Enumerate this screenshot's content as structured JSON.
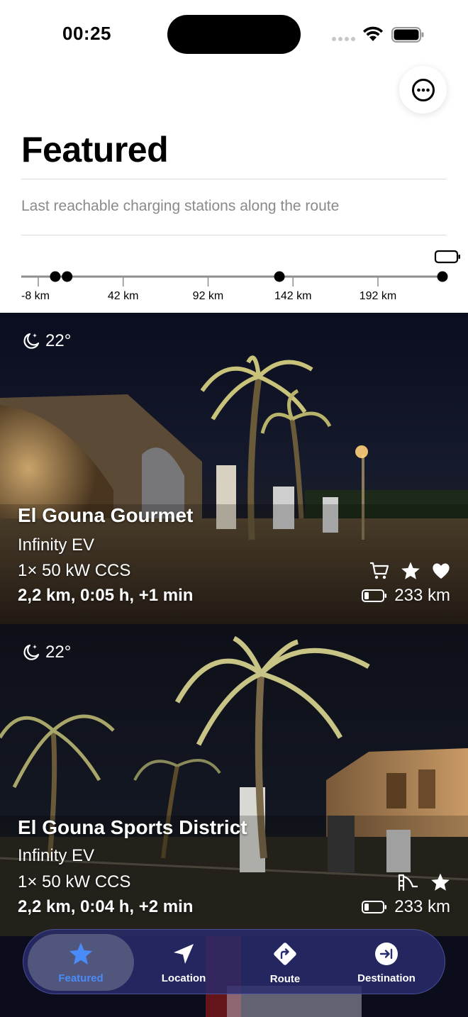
{
  "status_bar": {
    "time": "00:25"
  },
  "header": {
    "title": "Featured",
    "subtitle": "Last reachable charging stations along the route"
  },
  "timeline": {
    "ticks": [
      "-8 km",
      "42 km",
      "92 km",
      "142 km",
      "192 km"
    ],
    "station_markers_km": [
      2,
      9,
      134,
      230
    ]
  },
  "stations": [
    {
      "temperature": "22°",
      "name": "El Gouna Gourmet",
      "operator": "Infinity EV",
      "charger": "1× 50 kW CCS",
      "distance": "2,2 km, 0:05 h, +1 min",
      "range": "233 km",
      "amenities": [
        "cart-icon",
        "star-icon",
        "heart-icon"
      ]
    },
    {
      "temperature": "22°",
      "name": "El Gouna Sports District",
      "operator": "Infinity EV",
      "charger": "1× 50 kW CCS",
      "distance": "2,2 km, 0:04 h, +2 min",
      "range": "233 km",
      "amenities": [
        "playground-icon",
        "star-icon"
      ]
    }
  ],
  "tabs": [
    {
      "label": "Featured",
      "icon": "star-icon",
      "active": true
    },
    {
      "label": "Location",
      "icon": "location-arrow-icon",
      "active": false
    },
    {
      "label": "Route",
      "icon": "route-turn-icon",
      "active": false
    },
    {
      "label": "Destination",
      "icon": "destination-icon",
      "active": false
    }
  ],
  "colors": {
    "accent": "#4a8cf7",
    "tab_bar": "#282c6e"
  }
}
